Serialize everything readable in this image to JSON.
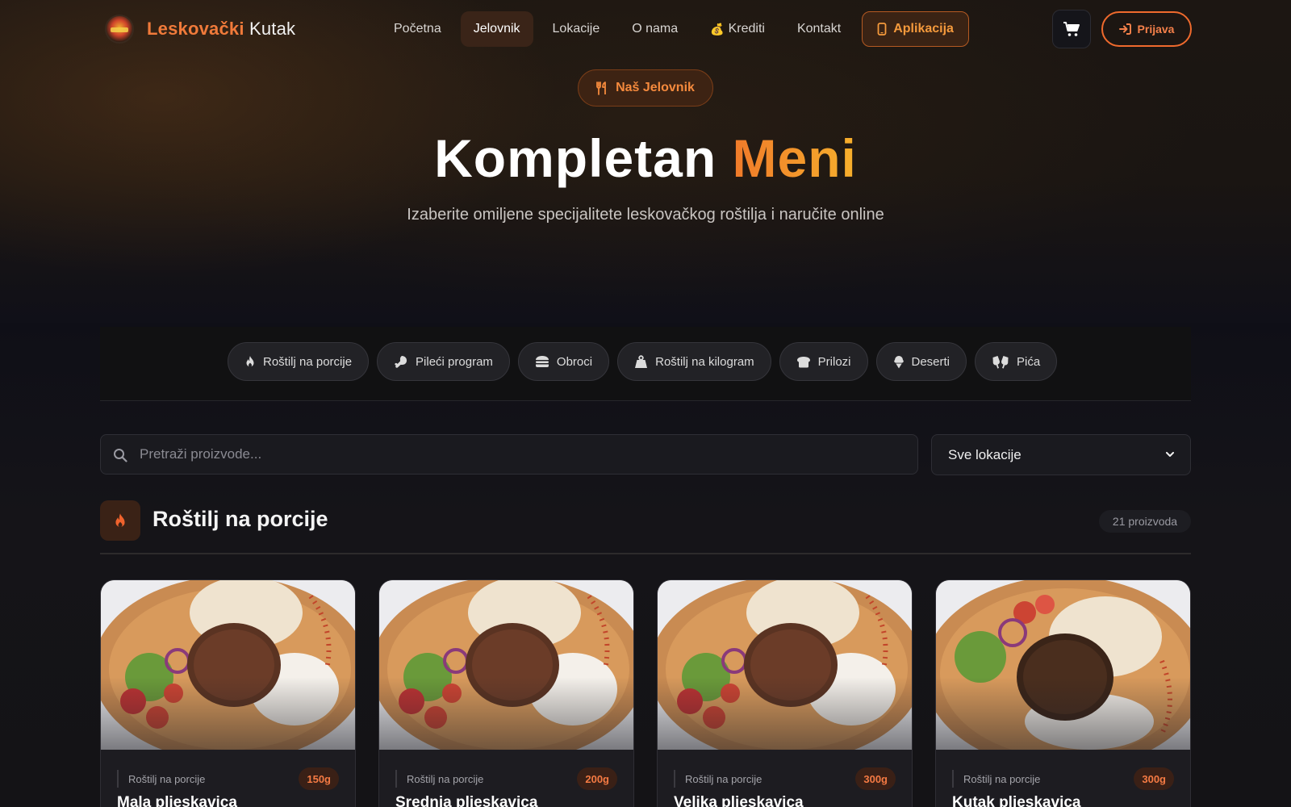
{
  "brand": {
    "part1": "Leskovački",
    "part2": "Kutak"
  },
  "nav": {
    "items": [
      {
        "label": "Početna"
      },
      {
        "label": "Jelovnik"
      },
      {
        "label": "Lokacije"
      },
      {
        "label": "O nama"
      },
      {
        "label": "Krediti",
        "icon": "💰"
      },
      {
        "label": "Kontakt"
      }
    ],
    "app_label": "Aplikacija",
    "login_label": "Prijava",
    "active": "Jelovnik"
  },
  "hero": {
    "pill": "Naš Jelovnik",
    "title_main": "Kompletan",
    "title_accent": "Meni",
    "subtitle": "Izaberite omiljene specijalitete leskovačkog roštilja i naručite online"
  },
  "categories": [
    {
      "label": "Roštilj na porcije",
      "icon": "fire-icon"
    },
    {
      "label": "Pileći program",
      "icon": "drumstick-icon"
    },
    {
      "label": "Obroci",
      "icon": "burger-icon"
    },
    {
      "label": "Roštilj na kilogram",
      "icon": "weight-icon"
    },
    {
      "label": "Prilozi",
      "icon": "bread-icon"
    },
    {
      "label": "Deserti",
      "icon": "ice-cream-icon"
    },
    {
      "label": "Pića",
      "icon": "glasses-icon"
    }
  ],
  "search": {
    "placeholder": "Pretraži proizvode...",
    "value": ""
  },
  "location_select": {
    "selected": "Sve lokacije"
  },
  "section": {
    "title": "Roštilj na porcije",
    "count": "21 proizvoda"
  },
  "products": [
    {
      "name": "Mala pljeskavica",
      "category": "Roštilj na porcije",
      "weight": "150g"
    },
    {
      "name": "Srednja pljeskavica",
      "category": "Roštilj na porcije",
      "weight": "200g"
    },
    {
      "name": "Velika pljeskavica",
      "category": "Roštilj na porcije",
      "weight": "300g"
    },
    {
      "name": "Kutak pljeskavica",
      "category": "Roštilj na porcije",
      "weight": "300g"
    }
  ],
  "colors": {
    "accent": "#ef6a2d",
    "accent_gold": "#f6b02c",
    "background": "#111014"
  }
}
